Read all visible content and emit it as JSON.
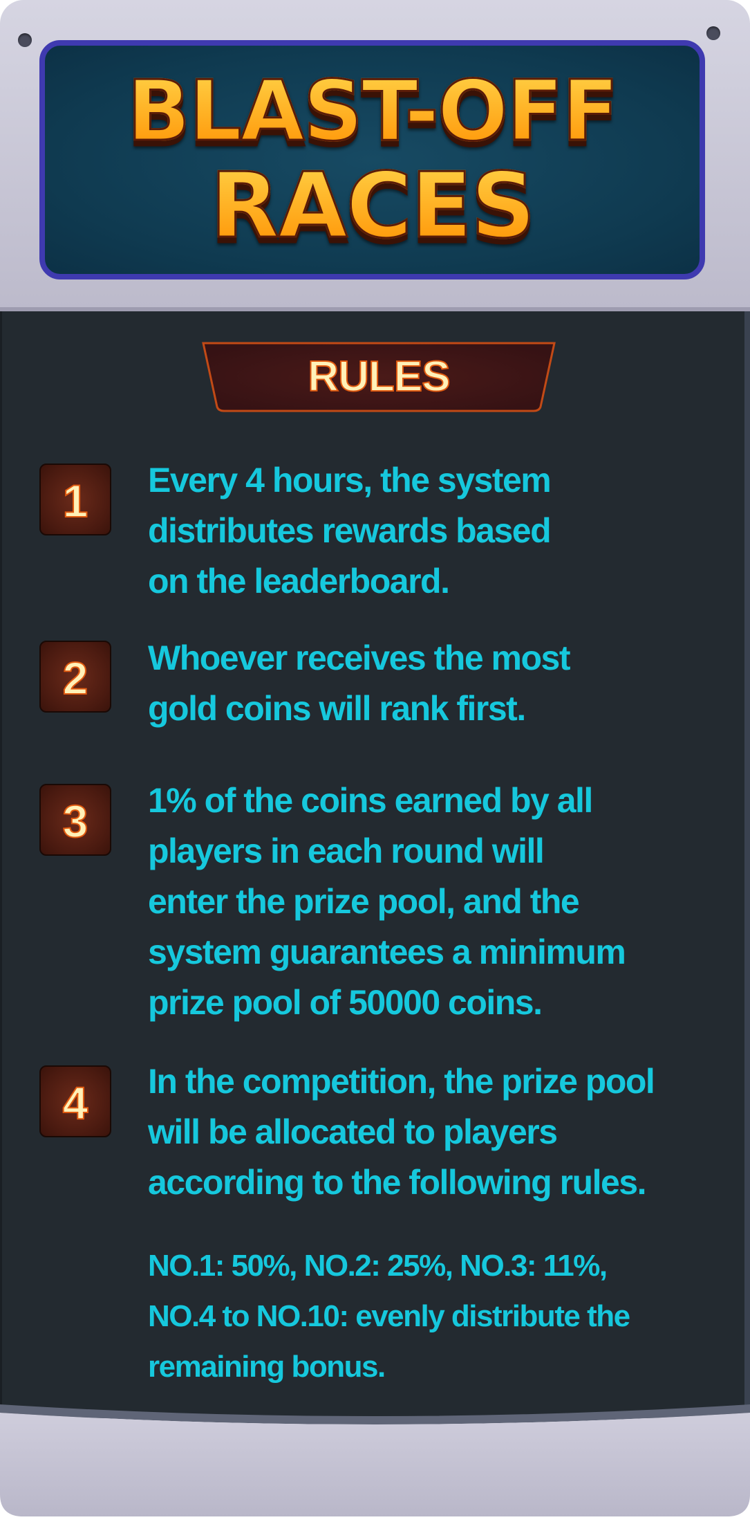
{
  "title": {
    "line1": "BLAST-OFF",
    "line2": "RACES"
  },
  "rules_header": "RULES",
  "rules": [
    {
      "number": "1",
      "text": "Every 4 hours, the system\ndistributes rewards based\non the leaderboard."
    },
    {
      "number": "2",
      "text": "Whoever receives the most\n gold coins will rank first."
    },
    {
      "number": "3",
      "text": "1% of the coins earned by all\nplayers in each round will\nenter the prize pool, and the\nsystem guarantees a minimum\nprize pool of 50000 coins."
    },
    {
      "number": "4",
      "text": "In the competition, the prize pool\nwill be allocated to players\naccording to the following rules."
    }
  ],
  "distribution": "NO.1: 50%, NO.2: 25%, NO.3: 11%,\nNO.4 to NO.10: evenly distribute the\nremaining bonus.",
  "colors": {
    "body_bg": "#232a30",
    "rule_text": "#16c8dd",
    "title_gold": "#ffb300",
    "frame_gray": "#c8c6d6",
    "screen_border": "#3f3ab0"
  }
}
